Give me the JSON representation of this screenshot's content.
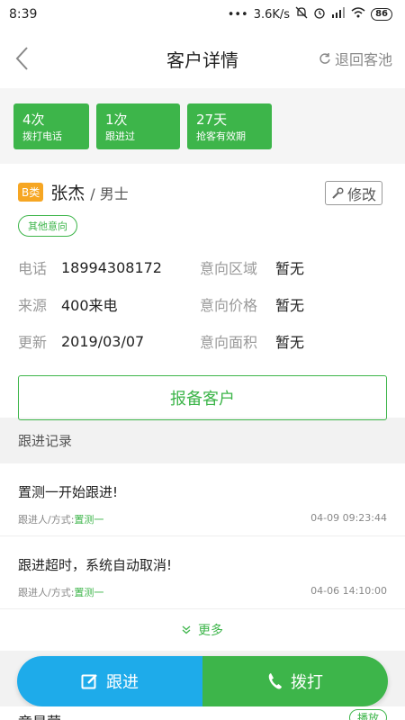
{
  "status": {
    "time": "8:39",
    "speed": "3.6K/s",
    "battery": "86"
  },
  "nav": {
    "title": "客户详情",
    "right_label": "退回客池"
  },
  "stats": [
    {
      "num": "4次",
      "label": "拨打电话"
    },
    {
      "num": "1次",
      "label": "跟进过"
    },
    {
      "num": "27天",
      "label": "抢客有效期"
    }
  ],
  "customer": {
    "grade": "B类",
    "name": "张杰",
    "gender": "/ 男士",
    "edit_label": "修改",
    "intent_tag": "其他意向",
    "phone_key": "电话",
    "phone": "18994308172",
    "source_key": "来源",
    "source": "400来电",
    "updated_key": "更新",
    "updated": "2019/03/07",
    "area_key": "意向区域",
    "area": "暂无",
    "price_key": "意向价格",
    "price": "暂无",
    "size_key": "意向面积",
    "size": "暂无",
    "report_label": "报备客户"
  },
  "followup": {
    "section_title": "跟进记录",
    "records": [
      {
        "title": "置测一开始跟进!",
        "meta_prefix": "跟进人/方式:",
        "who": "置测一",
        "time": "04-09 09:23:44"
      },
      {
        "title": "跟进超时，系统自动取消!",
        "meta_prefix": "跟进人/方式:",
        "who": "置测一",
        "time": "04-06 14:10:00"
      }
    ],
    "more_label": "更多"
  },
  "actions": {
    "follow_label": "跟进",
    "call_label": "拨打"
  },
  "peek": {
    "name": "章昊荣",
    "play_label": "播放"
  },
  "colors": {
    "green": "#3db54a",
    "blue": "#1eabea",
    "orange": "#f6a623"
  }
}
